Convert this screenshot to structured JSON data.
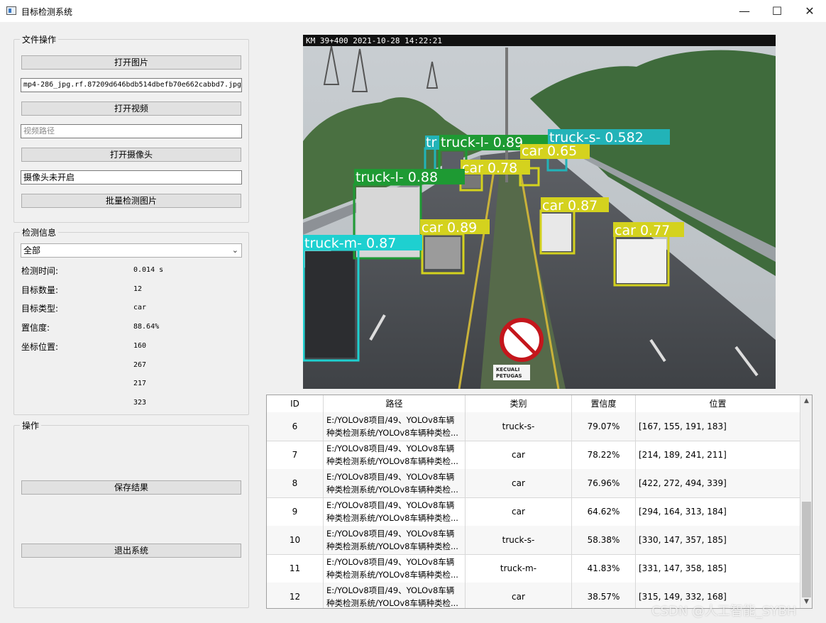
{
  "window": {
    "title": "目标检测系统",
    "minimize": "—",
    "maximize": "☐",
    "close": "✕"
  },
  "file_ops": {
    "group_title": "文件操作",
    "open_image": "打开图片",
    "image_path": "mp4-286_jpg.rf.87209d646bdb514dbefb70e662cabbd7.jpg",
    "open_video": "打开视频",
    "video_placeholder": "视频路径",
    "open_camera": "打开摄像头",
    "camera_status": "摄像头未开启",
    "batch_detect": "批量检测图片"
  },
  "detect_info": {
    "group_title": "检测信息",
    "filter_selected": "全部",
    "time_label": "检测时间:",
    "time_value": "0.014 s",
    "count_label": "目标数量:",
    "count_value": "12",
    "type_label": "目标类型:",
    "type_value": "car",
    "conf_label": "置信度:",
    "conf_value": "88.64%",
    "pos_label": "坐标位置:",
    "pos_values": [
      "160",
      "267",
      "217",
      "323"
    ]
  },
  "ops": {
    "group_title": "操作",
    "save": "保存结果",
    "exit": "退出系统"
  },
  "image": {
    "timestamp": "KM 39+400  2021-10-28  14:22:21",
    "sign_text": "KECUALI\nPETUGAS",
    "labels": [
      "truck-l- 0.89",
      "truck-s- 0.582",
      "tr",
      "car 0.65",
      "car 0.78",
      "truck-l- 0.88",
      "car 0.87",
      "car 0.89",
      "car 0.77",
      "truck-m- 0.87"
    ],
    "colors": {
      "car": "#d4d21e",
      "truck_l": "#1e9a33",
      "truck_s": "#22b3b8",
      "truck_m": "#1ed0d0"
    }
  },
  "table": {
    "headers": [
      "ID",
      "路径",
      "类别",
      "置信度",
      "位置"
    ],
    "rows": [
      {
        "id": "6",
        "path": "E:/YOLOv8项目/49、YOLOv8车辆\n种类检测系统/YOLOv8车辆种类检...",
        "type": "truck-s-",
        "conf": "79.07%",
        "pos": "[167, 155, 191, 183]"
      },
      {
        "id": "7",
        "path": "E:/YOLOv8项目/49、YOLOv8车辆\n种类检测系统/YOLOv8车辆种类检...",
        "type": "car",
        "conf": "78.22%",
        "pos": "[214, 189, 241, 211]"
      },
      {
        "id": "8",
        "path": "E:/YOLOv8项目/49、YOLOv8车辆\n种类检测系统/YOLOv8车辆种类检...",
        "type": "car",
        "conf": "76.96%",
        "pos": "[422, 272, 494, 339]"
      },
      {
        "id": "9",
        "path": "E:/YOLOv8项目/49、YOLOv8车辆\n种类检测系统/YOLOv8车辆种类检...",
        "type": "car",
        "conf": "64.62%",
        "pos": "[294, 164, 313, 184]"
      },
      {
        "id": "10",
        "path": "E:/YOLOv8项目/49、YOLOv8车辆\n种类检测系统/YOLOv8车辆种类检...",
        "type": "truck-s-",
        "conf": "58.38%",
        "pos": "[330, 147, 357, 185]"
      },
      {
        "id": "11",
        "path": "E:/YOLOv8项目/49、YOLOv8车辆\n种类检测系统/YOLOv8车辆种类检...",
        "type": "truck-m-",
        "conf": "41.83%",
        "pos": "[331, 147, 358, 185]"
      },
      {
        "id": "12",
        "path": "E:/YOLOv8项目/49、YOLOv8车辆\n种类检测系统/YOLOv8车辆种类检...",
        "type": "car",
        "conf": "38.57%",
        "pos": "[315, 149, 332, 168]"
      }
    ],
    "scroll_up": "▲",
    "scroll_down": "▼"
  },
  "watermark": "CSDN @人工智能_SYBH"
}
